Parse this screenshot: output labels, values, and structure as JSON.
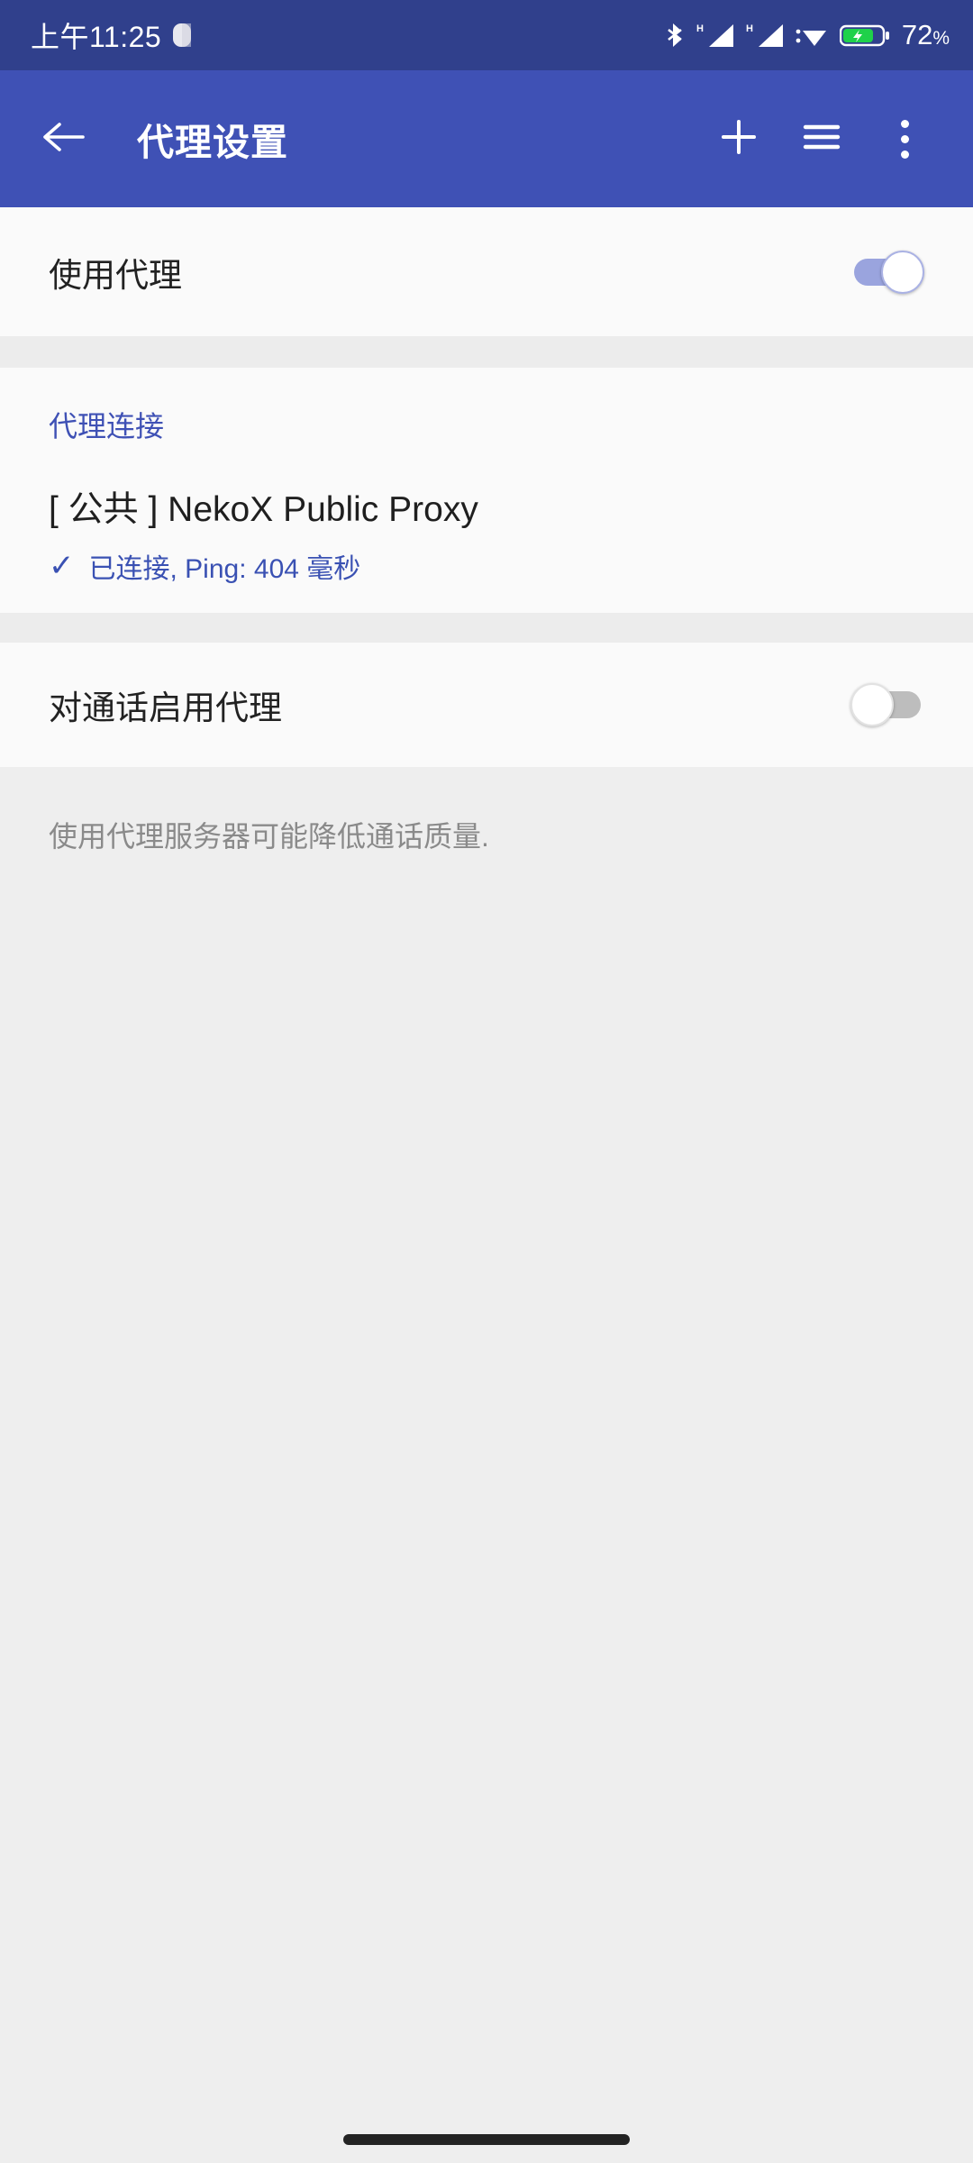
{
  "status_bar": {
    "clock": "上午11:25",
    "battery_level": "72",
    "battery_unit": "%",
    "icons": [
      "bluetooth-icon",
      "signal-h-icon",
      "signal-h-icon",
      "wifi-icon",
      "battery-charging-icon"
    ],
    "background_color": "#30408c"
  },
  "app_bar": {
    "title": "代理设置",
    "back_icon": "arrow-left-icon",
    "actions": [
      "plus-icon",
      "hamburger-icon",
      "overflow-menu-icon"
    ],
    "background_color": "#3f51b5"
  },
  "use_proxy_row": {
    "label": "使用代理",
    "toggle_state": "on",
    "toggle_color": "#9aa4de"
  },
  "proxy_section": {
    "header": "代理连接",
    "item": {
      "title": "[ 公共 ] NekoX Public Proxy",
      "status_check": "✓",
      "status_text": "已连接, Ping: 404 毫秒",
      "status_color": "#3a51b3"
    }
  },
  "calls_row": {
    "label": "对通话启用代理",
    "toggle_state": "off",
    "toggle_color": "#bdbdbd"
  },
  "footer": {
    "note": "使用代理服务器可能降低通话质量."
  }
}
